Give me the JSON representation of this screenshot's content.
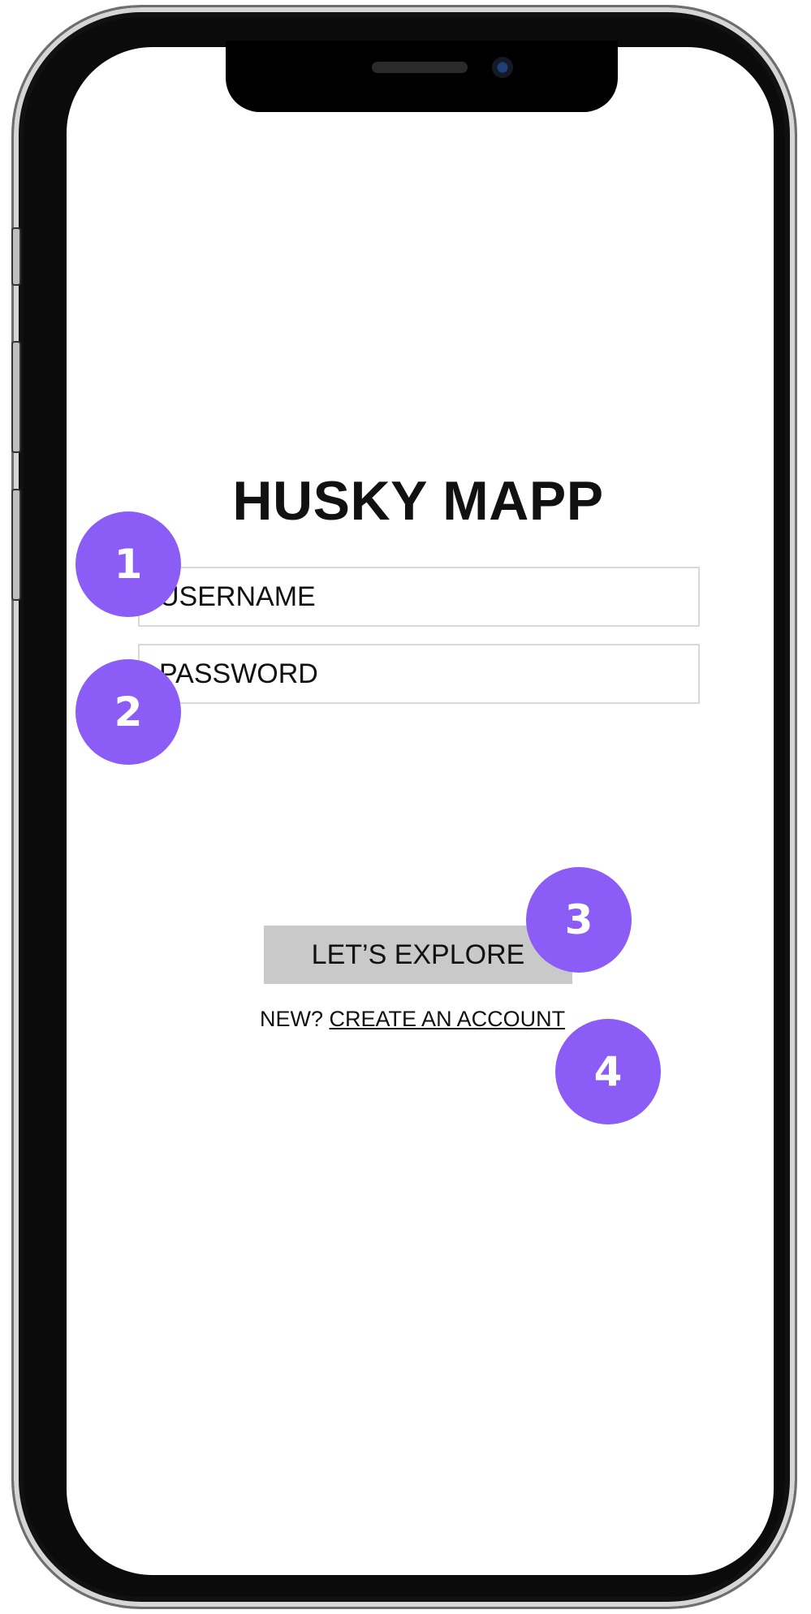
{
  "app": {
    "title": "HUSKY MAPP"
  },
  "login": {
    "username_placeholder": "USERNAME",
    "password_placeholder": "PASSWORD",
    "explore_label": "LET’S EXPLORE",
    "new_prompt": "NEW?",
    "create_account_label": "CREATE AN ACCOUNT"
  },
  "annotations": {
    "markers": [
      "1",
      "2",
      "3",
      "4"
    ],
    "color": "#8b5cf6"
  },
  "icons": {
    "camera": "camera-lens-icon",
    "speaker": "earpiece-speaker-icon"
  }
}
